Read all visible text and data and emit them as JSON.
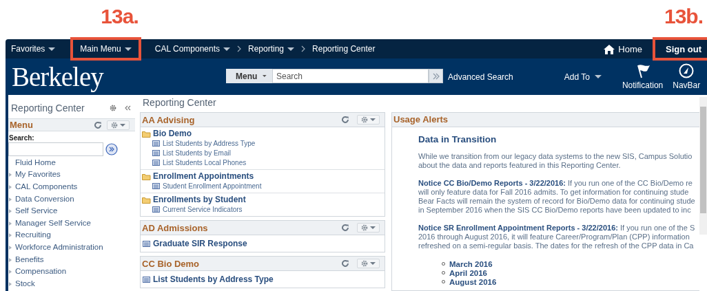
{
  "top_nav": {
    "menus": [
      {
        "label": "Favorites",
        "dropdown": true
      },
      {
        "label": "Main Menu",
        "dropdown": true,
        "callout": "13a."
      }
    ],
    "breadcrumbs": [
      {
        "label": "CAL Components",
        "dropdown": true
      },
      {
        "label": "Reporting",
        "dropdown": true
      },
      {
        "label": "Reporting Center",
        "dropdown": false
      }
    ],
    "home": {
      "label": "Home"
    },
    "sign_out": {
      "label": "Sign out",
      "callout": "13b."
    }
  },
  "header": {
    "logo": "Berkeley",
    "search_menu": "Menu",
    "search_placeholder": "Search",
    "advanced_search": "Advanced Search",
    "add_to": "Add To",
    "notification": "Notification",
    "navbar": "NavBar"
  },
  "sidebar": {
    "title": "Reporting Center",
    "pagelet_title": "Menu",
    "search_label": "Search:",
    "items": [
      {
        "label": "Fluid Home",
        "has_children": false
      },
      {
        "label": "My Favorites",
        "has_children": true
      },
      {
        "label": "CAL Components",
        "has_children": true
      },
      {
        "label": "Data Conversion",
        "has_children": true
      },
      {
        "label": "Self Service",
        "has_children": true
      },
      {
        "label": "Manager Self Service",
        "has_children": true
      },
      {
        "label": "Recruiting",
        "has_children": true
      },
      {
        "label": "Workforce Administration",
        "has_children": true
      },
      {
        "label": "Benefits",
        "has_children": true
      },
      {
        "label": "Compensation",
        "has_children": true
      },
      {
        "label": "Stock",
        "has_children": true
      }
    ]
  },
  "main": {
    "title": "Reporting Center",
    "pagelets": [
      {
        "title": "AA Advising",
        "kind": "folders",
        "folders": [
          {
            "label": "Bio Demo",
            "links": [
              "List Students by Address Type",
              "List Students by Email",
              "List Students Local Phones"
            ]
          },
          {
            "label": "Enrollment Appointments",
            "links": [
              "Student Enrollment Appointment"
            ]
          },
          {
            "label": "Enrollments by Student",
            "links": [
              "Current Service Indicators"
            ]
          }
        ]
      },
      {
        "title": "AD Admissions",
        "kind": "links",
        "links": [
          "Graduate SIR Response"
        ]
      },
      {
        "title": "CC Bio Demo",
        "kind": "links",
        "links": [
          "List Students by Address Type"
        ]
      }
    ]
  },
  "usage_alerts": {
    "title": "Usage Alerts",
    "heading": "Data in Transition",
    "paragraphs": [
      [
        "While we transition from our legacy data systems to the new SIS, Campus Solutio",
        "about the data and reports featured in this Reporting Center."
      ],
      [
        "**Notice CC Bio/Demo Reports - 3/22/2016:** If you run one of the CC Bio/Demo re",
        "will only feature data for Fall 2016 admits. To get information for continuing stude",
        "Bear Facts will remain the system of record for Bio/Demo data for continuing stude",
        "in September 2016 when the SIS CC Bio/Demo reports have been updated to inc"
      ],
      [
        "**Notice SR Enrollment Appointment Reports - 3/22/2016:** If you run one of the S",
        "2016 through August 2016, it will feature Career/Program/Plan (CPP) information",
        "refreshed on a semi-regular basis. The dates for the refresh of the CPP data in Ca"
      ]
    ],
    "dates": [
      "March 2016",
      "April 2016",
      "August 2016"
    ]
  }
}
